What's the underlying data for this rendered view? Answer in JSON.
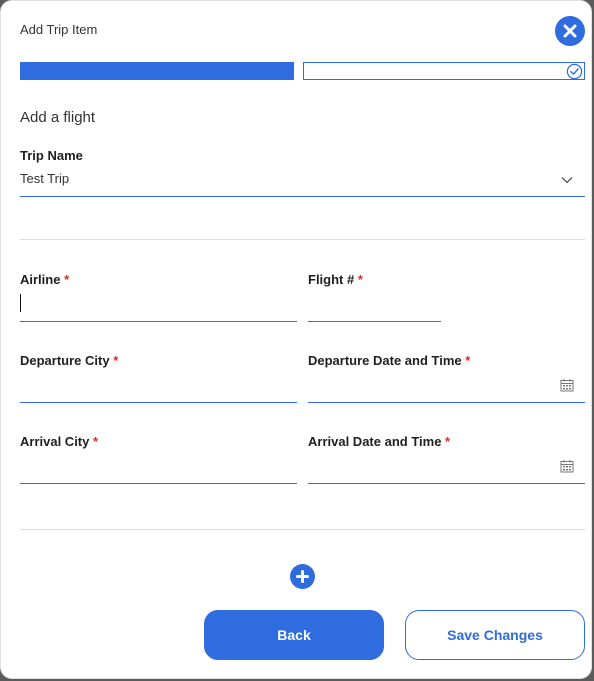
{
  "dialog": {
    "title": "Add Trip Item",
    "section_title": "Add a flight"
  },
  "trip_name": {
    "label": "Trip Name",
    "value": "Test Trip"
  },
  "fields": {
    "airline_label": "Airline",
    "flight_label": "Flight #",
    "departure_city_label": "Departure City",
    "departure_datetime_label": "Departure Date and Time",
    "arrival_city_label": "Arrival City",
    "arrival_datetime_label": "Arrival Date and Time",
    "required_marker": "*"
  },
  "buttons": {
    "back": "Back",
    "save": "Save Changes"
  },
  "progress": {
    "total_steps": 2,
    "completed_steps": 1
  },
  "colors": {
    "accent": "#2e6ce0",
    "required": "#d32f2f"
  },
  "icons": {
    "close": "close-icon",
    "check": "check-circle-icon",
    "chevron": "chevron-down-icon",
    "calendar": "calendar-icon",
    "add": "plus-circle-icon"
  }
}
